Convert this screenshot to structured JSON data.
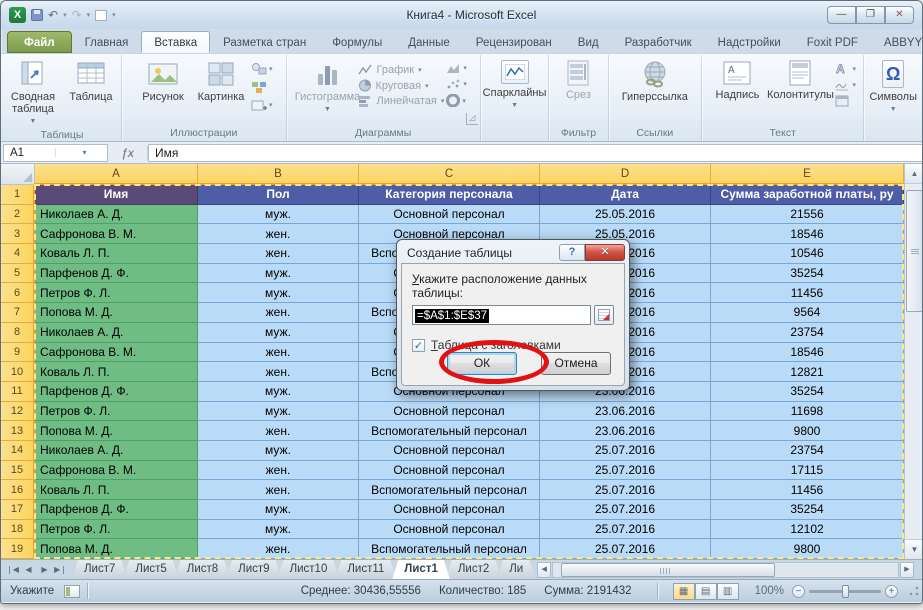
{
  "window": {
    "title": "Книга4  -  Microsoft Excel"
  },
  "tabs": [
    {
      "label": "Файл",
      "file": true,
      "active": false
    },
    {
      "label": "Главная",
      "file": false,
      "active": false
    },
    {
      "label": "Вставка",
      "file": false,
      "active": true
    },
    {
      "label": "Разметка стран",
      "file": false,
      "active": false
    },
    {
      "label": "Формулы",
      "file": false,
      "active": false
    },
    {
      "label": "Данные",
      "file": false,
      "active": false
    },
    {
      "label": "Рецензирован",
      "file": false,
      "active": false
    },
    {
      "label": "Вид",
      "file": false,
      "active": false
    },
    {
      "label": "Разработчик",
      "file": false,
      "active": false
    },
    {
      "label": "Надстройки",
      "file": false,
      "active": false
    },
    {
      "label": "Foxit PDF",
      "file": false,
      "active": false
    },
    {
      "label": "ABBYY PDF Tran",
      "file": false,
      "active": false
    }
  ],
  "ribbon": {
    "tables": {
      "group": "Таблицы",
      "pivot": "Сводная таблица",
      "table": "Таблица"
    },
    "illustrations": {
      "group": "Иллюстрации",
      "picture": "Рисунок",
      "clipart": "Картинка"
    },
    "charts": {
      "group": "Диаграммы",
      "histogram": "Гистограмма",
      "line": "График",
      "pie": "Круговая",
      "bar": "Линейчатая"
    },
    "sparklines": {
      "button": "Спарклайны"
    },
    "filter": {
      "group": "Фильтр",
      "slicer": "Срез"
    },
    "links": {
      "group": "Ссылки",
      "hyperlink": "Гиперссылка"
    },
    "text": {
      "group": "Текст",
      "textbox": "Надпись",
      "headerfooter": "Колонтитулы"
    },
    "symbols": {
      "group": "Символы",
      "button": "Символы"
    }
  },
  "formula_bar": {
    "name_box": "A1",
    "fx": "ƒx",
    "value": "Имя"
  },
  "sheet": {
    "columns": [
      "A",
      "B",
      "C",
      "D",
      "E"
    ],
    "rows": [
      [
        "1",
        "Имя",
        "Пол",
        "Категория персонала",
        "Дата",
        "Сумма заработной платы, ру"
      ],
      [
        "2",
        "Николаев А. Д.",
        "муж.",
        "Основной персонал",
        "25.05.2016",
        "21556"
      ],
      [
        "3",
        "Сафронова В. М.",
        "жен.",
        "Основной персонал",
        "25.05.2016",
        "18546"
      ],
      [
        "4",
        "Коваль Л. П.",
        "жен.",
        "Вспомогательный персонал",
        "25.05.2016",
        "10546"
      ],
      [
        "5",
        "Парфенов Д. Ф.",
        "муж.",
        "Основной персонал",
        "25.05.2016",
        "35254"
      ],
      [
        "6",
        "Петров Ф. Л.",
        "муж.",
        "Основной персонал",
        "25.05.2016",
        "11456"
      ],
      [
        "7",
        "Попова М. Д.",
        "жен.",
        "Вспомогательный персонал",
        "25.05.2016",
        "9564"
      ],
      [
        "8",
        "Николаев А. Д.",
        "муж.",
        "Основной персонал",
        "23.06.2016",
        "23754"
      ],
      [
        "9",
        "Сафронова В. М.",
        "жен.",
        "Основной персонал",
        "23.06.2016",
        "18546"
      ],
      [
        "10",
        "Коваль Л. П.",
        "жен.",
        "Вспомогательный персонал",
        "23.06.2016",
        "12821"
      ],
      [
        "11",
        "Парфенов Д. Ф.",
        "муж.",
        "Основной персонал",
        "23.06.2016",
        "35254"
      ],
      [
        "12",
        "Петров Ф. Л.",
        "муж.",
        "Основной персонал",
        "23.06.2016",
        "11698"
      ],
      [
        "13",
        "Попова М. Д.",
        "жен.",
        "Вспомогательный персонал",
        "23.06.2016",
        "9800"
      ],
      [
        "14",
        "Николаев А. Д.",
        "муж.",
        "Основной персонал",
        "25.07.2016",
        "23754"
      ],
      [
        "15",
        "Сафронова В. М.",
        "жен.",
        "Основной персонал",
        "25.07.2016",
        "17115"
      ],
      [
        "16",
        "Коваль Л. П.",
        "жен.",
        "Вспомогательный персонал",
        "25.07.2016",
        "11456"
      ],
      [
        "17",
        "Парфенов Д. Ф.",
        "муж.",
        "Основной персонал",
        "25.07.2016",
        "35254"
      ],
      [
        "18",
        "Петров Ф. Л.",
        "муж.",
        "Основной персонал",
        "25.07.2016",
        "12102"
      ],
      [
        "19",
        "Попова М. Д.",
        "жен.",
        "Вспомогательный персонал",
        "25.07.2016",
        "9800"
      ]
    ]
  },
  "dialog": {
    "title": "Создание таблицы",
    "prompt": "Укажите расположение данных таблицы:",
    "range": "=$A$1:$E$37",
    "checkbox_label": "Таблица с заголовками",
    "checkbox_checked": "✓",
    "ok": "ОК",
    "cancel": "Отмена",
    "help": "?",
    "close": "x"
  },
  "sheet_tabs": {
    "items": [
      "Лист7",
      "Лист5",
      "Лист8",
      "Лист9",
      "Лист10",
      "Лист11",
      "Лист1",
      "Лист2",
      "Ли"
    ],
    "active_index": 6
  },
  "status_bar": {
    "mode": "Укажите",
    "average": "Среднее: 30436,55556",
    "count": "Количество: 185",
    "sum": "Сумма: 2191432",
    "zoom": "100%"
  },
  "colors": {
    "table_header_a_fill": "#5a4a78",
    "table_header_fill": "#4d5ea6",
    "row_green": "#6fbd84",
    "row_blue": "#badbf7",
    "selected_header_amber": "#fbd560",
    "selected_header_amber_light": "#fde08e",
    "file_tab_green": "#7d9c4c",
    "annotation_red": "#e31212",
    "range_selection": "#000000"
  }
}
